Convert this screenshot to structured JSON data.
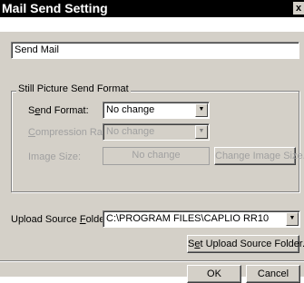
{
  "window": {
    "title": "Mail Send Setting",
    "close_glyph": "x"
  },
  "send_mail_field": {
    "value": "Send Mail"
  },
  "group": {
    "legend": "Still Picture Send Format",
    "send_format": {
      "label_pre": "S",
      "label_u": "e",
      "label_post": "nd Format:",
      "value": "No change"
    },
    "compression_rate": {
      "label_u": "C",
      "label_post": "ompression Rate:",
      "value": "No change",
      "enabled": false
    },
    "image_size": {
      "label": "Image Size:",
      "value": "No change",
      "enabled": false
    },
    "change_image_size_button": "Change Image Size..."
  },
  "upload_source": {
    "label_pre": "Upload Source ",
    "label_u": "F",
    "label_post": "older:",
    "value": "C:\\PROGRAM FILES\\CAPLIO RR10"
  },
  "set_upload_button": {
    "pre": "S",
    "u": "e",
    "post": "t Upload Source Folder..."
  },
  "ok_button": "OK",
  "cancel_button": "Cancel"
}
